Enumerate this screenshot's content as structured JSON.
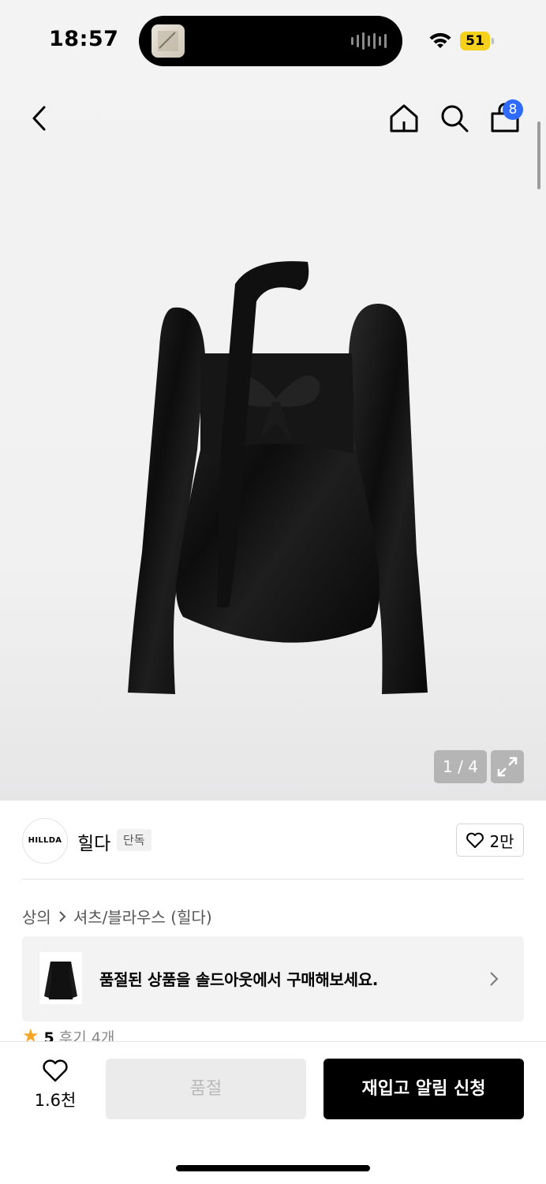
{
  "status_bar": {
    "time": "18:57",
    "battery": "51"
  },
  "nav": {
    "cart_count": "8"
  },
  "hero": {
    "image_counter": "1 / 4"
  },
  "brand": {
    "logo_text": "HILLDA",
    "name": "힐다",
    "tag": "단독",
    "likes": "2만"
  },
  "breadcrumb": {
    "items": [
      "상의",
      "셔츠/블라우스 (힐다)"
    ]
  },
  "soldout_banner": {
    "text": "품절된 상품을 솔드아웃에서 구매해보세요."
  },
  "review": {
    "score": "5",
    "label": "후기 4개"
  },
  "bottom_bar": {
    "like_count": "1.6천",
    "soldout_label": "품절",
    "restock_label": "재입고 알림 신청"
  },
  "colors": {
    "accent_blue": "#2f6bff",
    "battery_yellow": "#f5d11c",
    "star": "#f6a623"
  }
}
